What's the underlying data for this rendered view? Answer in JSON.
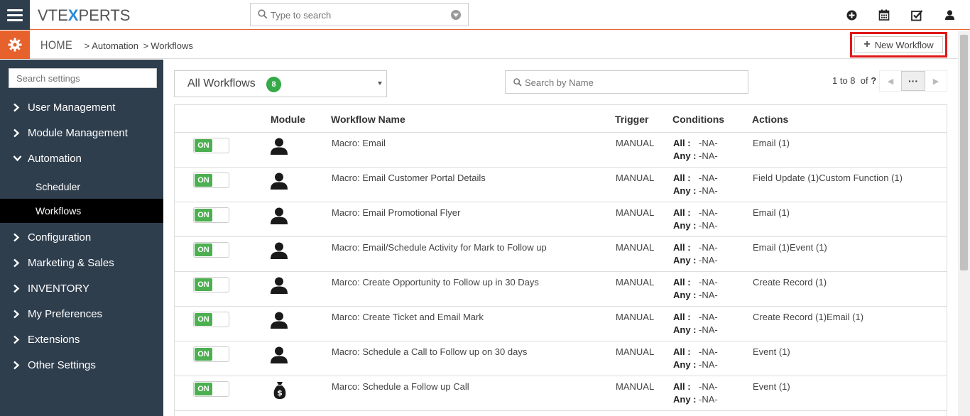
{
  "header": {
    "logo": {
      "part1": "VTE",
      "x": "X",
      "part2": "PERTS"
    },
    "search_placeholder": "Type to search",
    "icons": [
      "plus-circle-icon",
      "calendar-icon",
      "checkbox-icon",
      "user-icon"
    ]
  },
  "breadcrumb": {
    "home": "HOME",
    "sep": ">",
    "items": [
      "Automation",
      "Workflows"
    ]
  },
  "new_workflow_label": "New Workflow",
  "sidebar": {
    "search_placeholder": "Search settings",
    "items": [
      {
        "label": "User Management",
        "expanded": false
      },
      {
        "label": "Module Management",
        "expanded": false
      },
      {
        "label": "Automation",
        "expanded": true
      },
      {
        "label": "Configuration",
        "expanded": false
      },
      {
        "label": "Marketing & Sales",
        "expanded": false
      },
      {
        "label": "INVENTORY",
        "expanded": false
      },
      {
        "label": "My Preferences",
        "expanded": false
      },
      {
        "label": "Extensions",
        "expanded": false
      },
      {
        "label": "Other Settings",
        "expanded": false
      }
    ],
    "sub_items": [
      "Scheduler",
      "Workflows"
    ],
    "active_sub": "Workflows"
  },
  "filter": {
    "label": "All Workflows",
    "count": "8"
  },
  "name_search_placeholder": "Search by Name",
  "pager": {
    "range": "1 to 8",
    "of": "of",
    "total": "?",
    "more": "···"
  },
  "table": {
    "headers": {
      "module": "Module",
      "name": "Workflow Name",
      "trigger": "Trigger",
      "conditions": "Conditions",
      "actions": "Actions"
    },
    "cond_all": "All :",
    "cond_any": "Any :",
    "rows": [
      {
        "status": "ON",
        "module_icon": "person-icon",
        "name": "Macro: Email",
        "trigger": "MANUAL",
        "all": "-NA-",
        "any": "-NA-",
        "actions": "Email (1)"
      },
      {
        "status": "ON",
        "module_icon": "person-icon",
        "name": "Macro: Email Customer Portal Details",
        "trigger": "MANUAL",
        "all": "-NA-",
        "any": "-NA-",
        "actions": "Field Update (1)Custom Function (1)"
      },
      {
        "status": "ON",
        "module_icon": "person-icon",
        "name": "Macro: Email Promotional Flyer",
        "trigger": "MANUAL",
        "all": "-NA-",
        "any": "-NA-",
        "actions": "Email (1)"
      },
      {
        "status": "ON",
        "module_icon": "person-icon",
        "name": "Macro: Email/Schedule Activity for Mark to Follow up",
        "trigger": "MANUAL",
        "all": "-NA-",
        "any": "-NA-",
        "actions": "Email (1)Event (1)"
      },
      {
        "status": "ON",
        "module_icon": "person-icon",
        "name": "Marco: Create Opportunity to Follow up in 30 Days",
        "trigger": "MANUAL",
        "all": "-NA-",
        "any": "-NA-",
        "actions": "Create Record (1)"
      },
      {
        "status": "ON",
        "module_icon": "person-icon",
        "name": "Marco: Create Ticket and Email Mark",
        "trigger": "MANUAL",
        "all": "-NA-",
        "any": "-NA-",
        "actions": "Create Record (1)Email (1)"
      },
      {
        "status": "ON",
        "module_icon": "person-icon",
        "name": "Macro: Schedule a Call to Follow up on 30 days",
        "trigger": "MANUAL",
        "all": "-NA-",
        "any": "-NA-",
        "actions": "Event (1)"
      },
      {
        "status": "ON",
        "module_icon": "money-bag-icon",
        "name": "Marco: Schedule a Follow up Call",
        "trigger": "MANUAL",
        "all": "-NA-",
        "any": "-NA-",
        "actions": "Event (1)"
      }
    ]
  },
  "colors": {
    "accent": "#e6612c",
    "sidebar": "#2f3e4d",
    "on": "#4caf50",
    "badge": "#35aa47",
    "highlight": "#e01818"
  }
}
